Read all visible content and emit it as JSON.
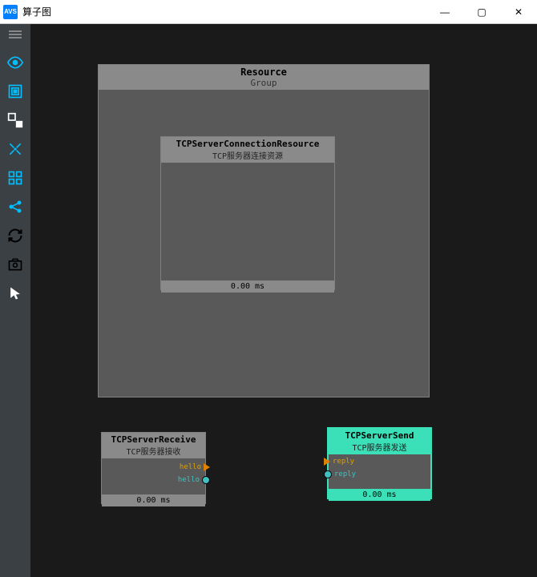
{
  "titlebar": {
    "title": "算子图",
    "app_icon_text": "AVS"
  },
  "win": {
    "minimize": "—",
    "maximize": "▢",
    "close": "✕"
  },
  "nodes": {
    "resource_group": {
      "title": "Resource",
      "subtitle": "Group"
    },
    "tcp_conn": {
      "title": "TCPServerConnectionResource",
      "subtitle": "TCP服务器连接资源",
      "time": "0.00 ms"
    },
    "tcp_recv": {
      "title": "TCPServerReceive",
      "subtitle": "TCP服务器接收",
      "time": "0.00 ms",
      "port1": "hello",
      "port2": "hello"
    },
    "tcp_send": {
      "title": "TCPServerSend",
      "subtitle": "TCP服务器发送",
      "time": "0.00 ms",
      "port1": "reply",
      "port2": "reply"
    }
  }
}
